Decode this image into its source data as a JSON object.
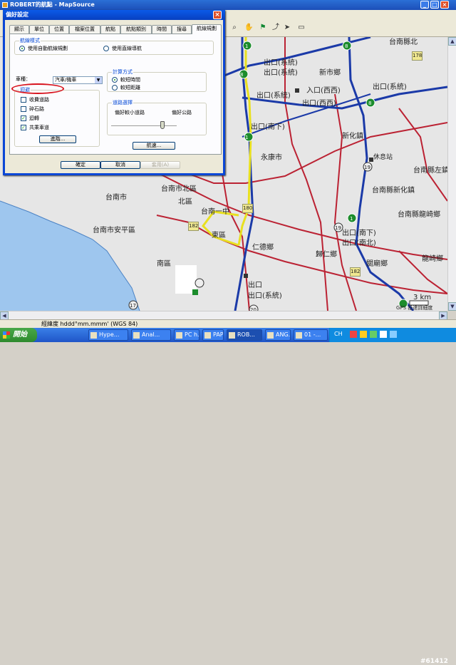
{
  "window": {
    "title": "ROBERT的航點 - MapSource"
  },
  "dialog": {
    "title": "偏好設定",
    "tabs": [
      "顯示",
      "單位",
      "位置",
      "檔案位置",
      "航點",
      "航點類別",
      "時間",
      "搜尋",
      "航線規劃"
    ],
    "route_method": {
      "legend": "航線樣式",
      "opt_auto": "使用自動航線規劃",
      "opt_direct": "使用直線導航",
      "selected": "使用自動航線規劃"
    },
    "vehicle": {
      "label": "車種：",
      "value": "汽車/機車"
    },
    "calc": {
      "legend": "計算方式",
      "opt_short_time": "較短時間",
      "opt_short_dist": "較短距離",
      "selected": "較短時間"
    },
    "avoid": {
      "legend": "迴避",
      "toll": "收費道路",
      "gravel": "碎石路",
      "uturn": "迴轉",
      "carpool": "共乘車道",
      "checked": [
        "迴轉",
        "共乘車道"
      ],
      "advanced": "進階..."
    },
    "road_select": {
      "legend": "道路選擇",
      "left": "偏好較小道路",
      "right": "偏好公路",
      "level": 0.8
    },
    "route_btn": "航速...",
    "ok": "確定",
    "cancel": "取消",
    "apply": "套用(A)"
  },
  "map": {
    "labels": {
      "tainan_city": "台南市",
      "north_dist": "台南市北區",
      "north": "北區",
      "anping": "台南市安平區",
      "east_dist": "台南一中",
      "east": "東區",
      "south": "南區",
      "rende": "仁德鄉",
      "yongkang": "永康市",
      "xinhua": "新化鎮",
      "xinshi": "新市鄉",
      "xinhua_county": "台南縣新化鎮",
      "zuozhen": "台南縣左鎮",
      "longqi": "台南縣龍崎鄉",
      "longqi2": "龍崎鄉",
      "guiren": "歸仁鄉",
      "guanmiao": "關廟鄉",
      "north_corner": "台南縣北",
      "station": "休息站",
      "exit_sys1": "出口(系統)",
      "exit_sys2": "出口(系統)",
      "exit_sys3": "出口(系統)",
      "exit_sys4": "出口(系統)",
      "entry_xixi": "入口(西西)",
      "exit_xixi": "出口(西西)",
      "exit_nanxia": "出口(南下)",
      "exit_nanxia2": "出口(南下)",
      "exit_nanbei": "出口(南北)",
      "exit_1": "出口",
      "exit_2": "出口",
      "exit_3": "出口",
      "rest_dist": "3 km",
      "gps_note": "GPS 抵達詳細度",
      "r1": "1",
      "r1b": "1",
      "r8": "8",
      "r8b": "8",
      "r8c": "8",
      "r1d": "1",
      "r17": "17",
      "r19": "19",
      "r19b": "19",
      "r20": "20",
      "r178": "178",
      "r180": "180",
      "r182": "182",
      "r182b": "182"
    }
  },
  "status": {
    "coord_format": "經緯度 hddd°mm.mmm' (WGS 84)"
  },
  "taskbar": {
    "start": "開始",
    "items": [
      "Hype...",
      "Anal...",
      "PC h...",
      "PAP...",
      "ROB...",
      "ANG...",
      "01 -..."
    ],
    "lang": "CH",
    "watermark": "#61412"
  }
}
